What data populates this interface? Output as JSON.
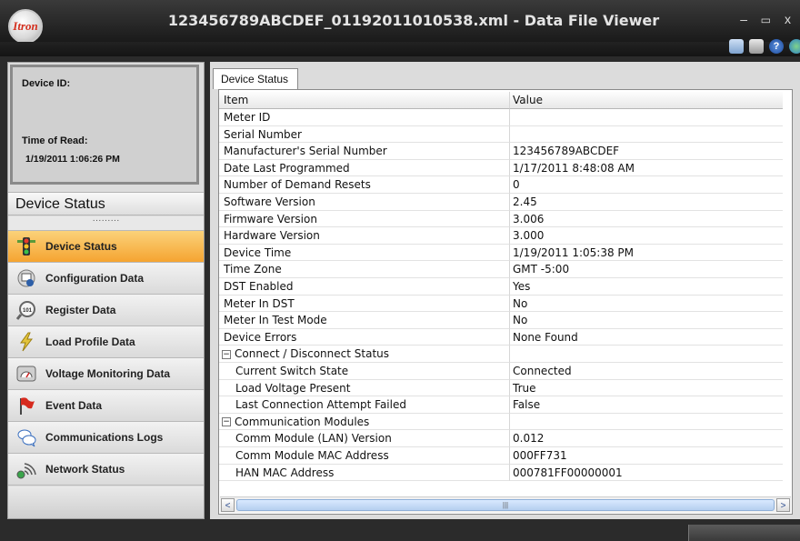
{
  "window": {
    "logo_text": "Itron",
    "title": "123456789ABCDEF_01192011010538.xml - Data File Viewer",
    "minimize": "–",
    "maximize": "▭",
    "close": "x"
  },
  "toolbar": {
    "icons": [
      "export-icon",
      "print-icon",
      "help-icon",
      "globe-icon"
    ]
  },
  "device_info": {
    "device_id_label": "Device ID:",
    "time_of_read_label": "Time of Read:",
    "time_of_read_value": "1/19/2011 1:06:26 PM"
  },
  "nav": {
    "header": "Device Status",
    "grip": "·········",
    "items": [
      {
        "label": "Device Status",
        "icon": "traffic-light-icon",
        "active": true
      },
      {
        "label": "Configuration Data",
        "icon": "config-icon",
        "active": false
      },
      {
        "label": "Register Data",
        "icon": "register-icon",
        "active": false
      },
      {
        "label": "Load Profile Data",
        "icon": "lightning-icon",
        "active": false
      },
      {
        "label": "Voltage Monitoring Data",
        "icon": "gauge-icon",
        "active": false
      },
      {
        "label": "Event Data",
        "icon": "flag-icon",
        "active": false
      },
      {
        "label": "Communications Logs",
        "icon": "chat-icon",
        "active": false
      },
      {
        "label": "Network Status",
        "icon": "network-icon",
        "active": false
      }
    ]
  },
  "main": {
    "tab": "Device Status",
    "columns": [
      "Item",
      "Value"
    ],
    "rows": [
      {
        "item": "Meter ID",
        "value": "",
        "indent": 0,
        "group": false
      },
      {
        "item": "Serial Number",
        "value": "",
        "indent": 0,
        "group": false
      },
      {
        "item": "Manufacturer's Serial Number",
        "value": "123456789ABCDEF",
        "indent": 0,
        "group": false
      },
      {
        "item": "Date Last Programmed",
        "value": "1/17/2011 8:48:08 AM",
        "indent": 0,
        "group": false
      },
      {
        "item": "Number of Demand Resets",
        "value": "0",
        "indent": 0,
        "group": false
      },
      {
        "item": "Software Version",
        "value": "2.45",
        "indent": 0,
        "group": false
      },
      {
        "item": "Firmware Version",
        "value": "3.006",
        "indent": 0,
        "group": false
      },
      {
        "item": "Hardware Version",
        "value": "3.000",
        "indent": 0,
        "group": false
      },
      {
        "item": "Device Time",
        "value": "1/19/2011 1:05:38 PM",
        "indent": 0,
        "group": false
      },
      {
        "item": "Time Zone",
        "value": "GMT -5:00",
        "indent": 0,
        "group": false
      },
      {
        "item": "DST Enabled",
        "value": "Yes",
        "indent": 0,
        "group": false
      },
      {
        "item": "Meter In DST",
        "value": "No",
        "indent": 0,
        "group": false
      },
      {
        "item": "Meter In Test Mode",
        "value": "No",
        "indent": 0,
        "group": false
      },
      {
        "item": "Device Errors",
        "value": "None Found",
        "indent": 0,
        "group": false
      },
      {
        "item": "Connect / Disconnect Status",
        "value": "",
        "indent": 0,
        "group": true
      },
      {
        "item": "Current Switch State",
        "value": "Connected",
        "indent": 1,
        "group": false
      },
      {
        "item": "Load Voltage Present",
        "value": "True",
        "indent": 1,
        "group": false
      },
      {
        "item": "Last Connection Attempt Failed",
        "value": "False",
        "indent": 1,
        "group": false
      },
      {
        "item": "Communication Modules",
        "value": "",
        "indent": 0,
        "group": true
      },
      {
        "item": "Comm Module (LAN) Version",
        "value": "0.012",
        "indent": 1,
        "group": false
      },
      {
        "item": "Comm Module MAC Address",
        "value": "000FF731",
        "indent": 1,
        "group": false
      },
      {
        "item": "HAN MAC Address",
        "value": "000781FF00000001",
        "indent": 1,
        "group": false
      }
    ],
    "scroll_left": "<",
    "scroll_right": ">",
    "scroll_grip": "|||"
  }
}
